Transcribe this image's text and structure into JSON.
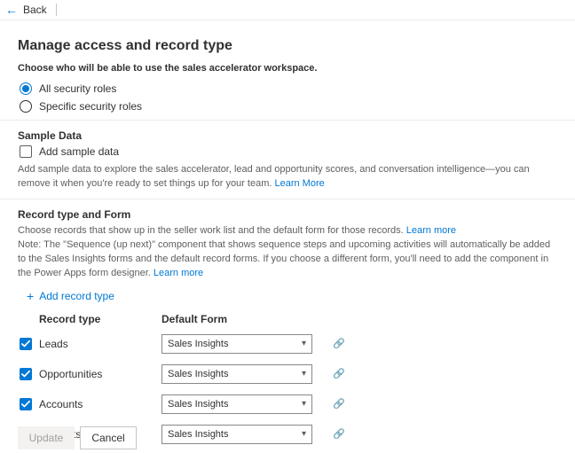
{
  "nav": {
    "back": "Back"
  },
  "title": "Manage access and record type",
  "subhead": "Choose who will be able to use the sales accelerator workspace.",
  "roles": {
    "all": "All security roles",
    "specific": "Specific security roles",
    "selected": "all"
  },
  "sample": {
    "heading": "Sample Data",
    "checkbox_label": "Add sample data",
    "help": "Add sample data to explore the sales accelerator, lead and opportunity scores, and conversation intelligence—you can remove it when you're ready to set things up for your team. ",
    "learn_more": "Learn More"
  },
  "record": {
    "heading": "Record type and Form",
    "desc": "Choose records that show up in the seller work list and the default form for those records. ",
    "learn_more": "Learn more",
    "note": "Note: The \"Sequence (up next)\" component that shows sequence steps and upcoming activities will automatically be added to the Sales Insights forms and the default record forms. If you choose a different form, you'll need to add the component in the Power Apps form designer. ",
    "note_learn": "Learn more",
    "add": "Add record type",
    "col_type": "Record type",
    "col_form": "Default Form",
    "rows": [
      {
        "label": "Leads",
        "form": "Sales Insights"
      },
      {
        "label": "Opportunities",
        "form": "Sales Insights"
      },
      {
        "label": "Accounts",
        "form": "Sales Insights"
      },
      {
        "label": "Contacts",
        "form": "Sales Insights"
      }
    ]
  },
  "footer": {
    "update": "Update",
    "cancel": "Cancel"
  }
}
